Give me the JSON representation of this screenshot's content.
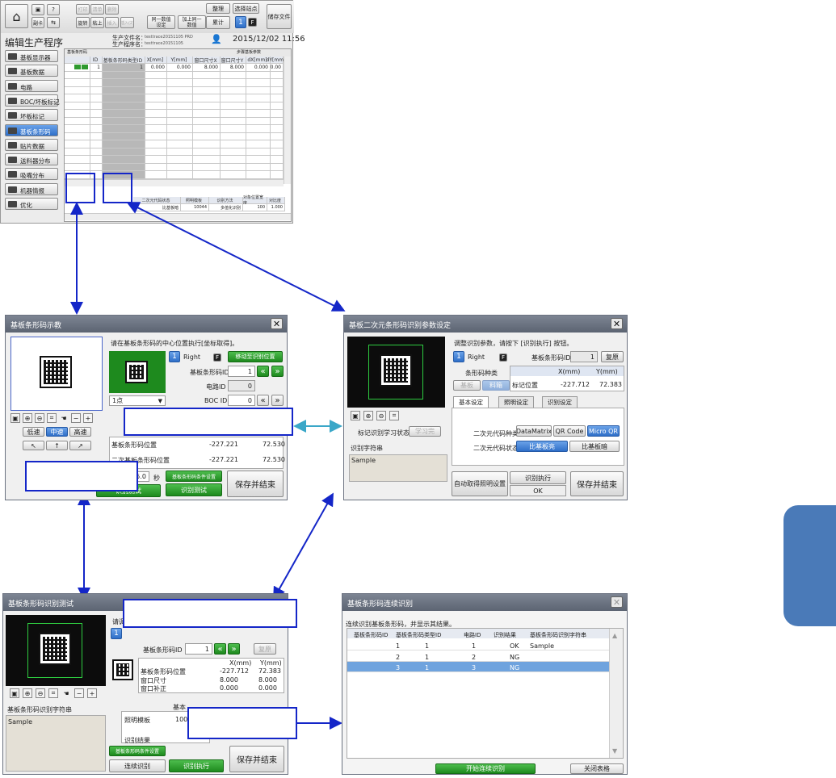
{
  "main": {
    "toolbar": {
      "home_label": "",
      "small1": "副卡",
      "small2": "",
      "small3": "",
      "print_label": "打印",
      "list_label": "清单",
      "delete_label": "删除",
      "rotate_label": "旋转",
      "paste_label": "粘上",
      "insert_label": "插入",
      "insert2_label": "插入(2)",
      "same_label": "同一数值\n设定",
      "add_label": "加上同一\n数值",
      "organize_label": "整理",
      "total_label": "累计",
      "select_station_label": "选择站点",
      "save_file_label": "储存文件",
      "station_num": "1",
      "station_f": "F"
    },
    "title": "编辑生产程序",
    "file_label": "生产文件名：",
    "file_value": "testtrace20151105 PRD",
    "program_label": "生产程序名：",
    "program_value": "testtrace20151105",
    "datetime": "2015/12/02 11:56",
    "sidebar": [
      "基板显示器",
      "基板数据",
      "电路",
      "BOC/坏板标记",
      "坏板标记",
      "基板条形码",
      "贴片数据",
      "送料器分布",
      "吸嘴分布",
      "机器情报",
      "优化"
    ],
    "grid_tab": "基板条形码",
    "grid_tab2": "步骤基板参数",
    "grid_headers": [
      "ID",
      "基板条形码类型ID",
      "X[mm]",
      "Y[mm]",
      "窗口尺寸X",
      "窗口尺寸Y",
      "dX[mm]",
      "dY[mm]"
    ],
    "grid_row": [
      "1",
      "1",
      "0.000",
      "0.000",
      "8.000",
      "8.000",
      "0.000",
      "0.00"
    ],
    "bottom_headers": [
      "二次元代码状态",
      "照明模板",
      "识别方法",
      "对象位置宽度",
      "对比度"
    ],
    "bottom_row": [
      "比基板暗",
      "10044",
      "多值化识别",
      "100",
      "1.000"
    ]
  },
  "w1": {
    "title": "基板条形码示教",
    "instruction": "请在基板条形码的中心位置执行[坐标取得]。",
    "num": "1",
    "side": "Right",
    "f": "F",
    "move_btn": "移动至识别位置",
    "barcode_id_label": "基板条形码ID",
    "barcode_id": "1",
    "circuit_label": "电路ID",
    "circuit_id": "0",
    "boc_label": "BOC ID",
    "boc_id": "0",
    "point_select": "1点",
    "speed": [
      "低速",
      "中速",
      "高速"
    ],
    "pos_label": "基板条形码位置",
    "pos_x": "-227.221",
    "pos_y": "72.530",
    "pos2_label": "二次基板条形码位置",
    "pos2_x": "-227.221",
    "pos2_y": "72.530",
    "timer": "5.0",
    "sec": "秒",
    "cond_btn": "基板条形码条件设置",
    "test_btn": "识别测试",
    "save_btn": "保存并结束"
  },
  "w2": {
    "title": "基板二次元条形码识别参数设定",
    "instruction": "调整识别参数，请按下 [识别执行] 按钮。",
    "num": "1",
    "side": "Right",
    "f": "F",
    "barcode_id_label": "基板条形码ID",
    "barcode_id": "1",
    "restore_btn": "复原",
    "type_label": "条形码种类",
    "type_opts": [
      "基板",
      "料箱"
    ],
    "col_x": "X(mm)",
    "col_y": "Y(mm)",
    "mark_pos_label": "标记位置",
    "mark_x": "-227.712",
    "mark_y": "72.383",
    "tabs": [
      "基本设定",
      "照明设定",
      "识别设定"
    ],
    "learn_label": "标记识别学习状态",
    "learn_btn": "学习完",
    "code_type_label": "二次元代码种类",
    "code_types": [
      "DataMatrix",
      "QR Code",
      "Micro QR"
    ],
    "state_label": "二次元代码状态",
    "states": [
      "比基板亮",
      "比基板暗"
    ],
    "str_label": "识别字符串",
    "str_value": "Sample",
    "auto_btn": "自动取得照明设置",
    "exec_btn": "识别执行",
    "ok_label": "OK",
    "save_btn": "保存并结束"
  },
  "w3": {
    "title": "基板条形码识别测试",
    "instruction": "请调整",
    "num": "1",
    "barcode_id_label": "基板条形码ID",
    "barcode_id": "1",
    "restore_btn": "复原",
    "col_x": "X(mm)",
    "col_y": "Y(mm)",
    "rows": [
      [
        "基板条形码位置",
        "-227.712",
        "72.383"
      ],
      [
        "窗口尺寸",
        "8.000",
        "8.000"
      ],
      [
        "窗口补正",
        "0.000",
        "0.000"
      ]
    ],
    "basic_label": "基本",
    "str_label": "基板条形码识别字符串",
    "str_value": "Sample",
    "light_label": "照明模板",
    "light_value": "100",
    "result_label": "识别结果",
    "cond_btn": "基板条形码条件设置",
    "cont_btn": "连续识别",
    "exec_btn": "识别执行",
    "save_btn": "保存并结束"
  },
  "w4": {
    "title": "基板条形码连续识别",
    "instruction": "连续识别基板条形码，并显示其结果。",
    "headers": [
      "基板条形码ID",
      "基板条形码类型ID",
      "电路ID",
      "识别结果",
      "基板条形码识别字符串"
    ],
    "rows": [
      [
        "1",
        "1",
        "1",
        "OK",
        "Sample"
      ],
      [
        "2",
        "1",
        "2",
        "NG",
        ""
      ],
      [
        "3",
        "1",
        "3",
        "NG",
        ""
      ]
    ],
    "start_btn": "开始连续识别",
    "close_btn": "关闭表格"
  },
  "colors": {
    "accent": "#2f6fc8",
    "green": "#1e8a1e",
    "arrow": "#1426c8",
    "teal": "#3aa7c8",
    "side_tab": "#4a7ab8"
  }
}
